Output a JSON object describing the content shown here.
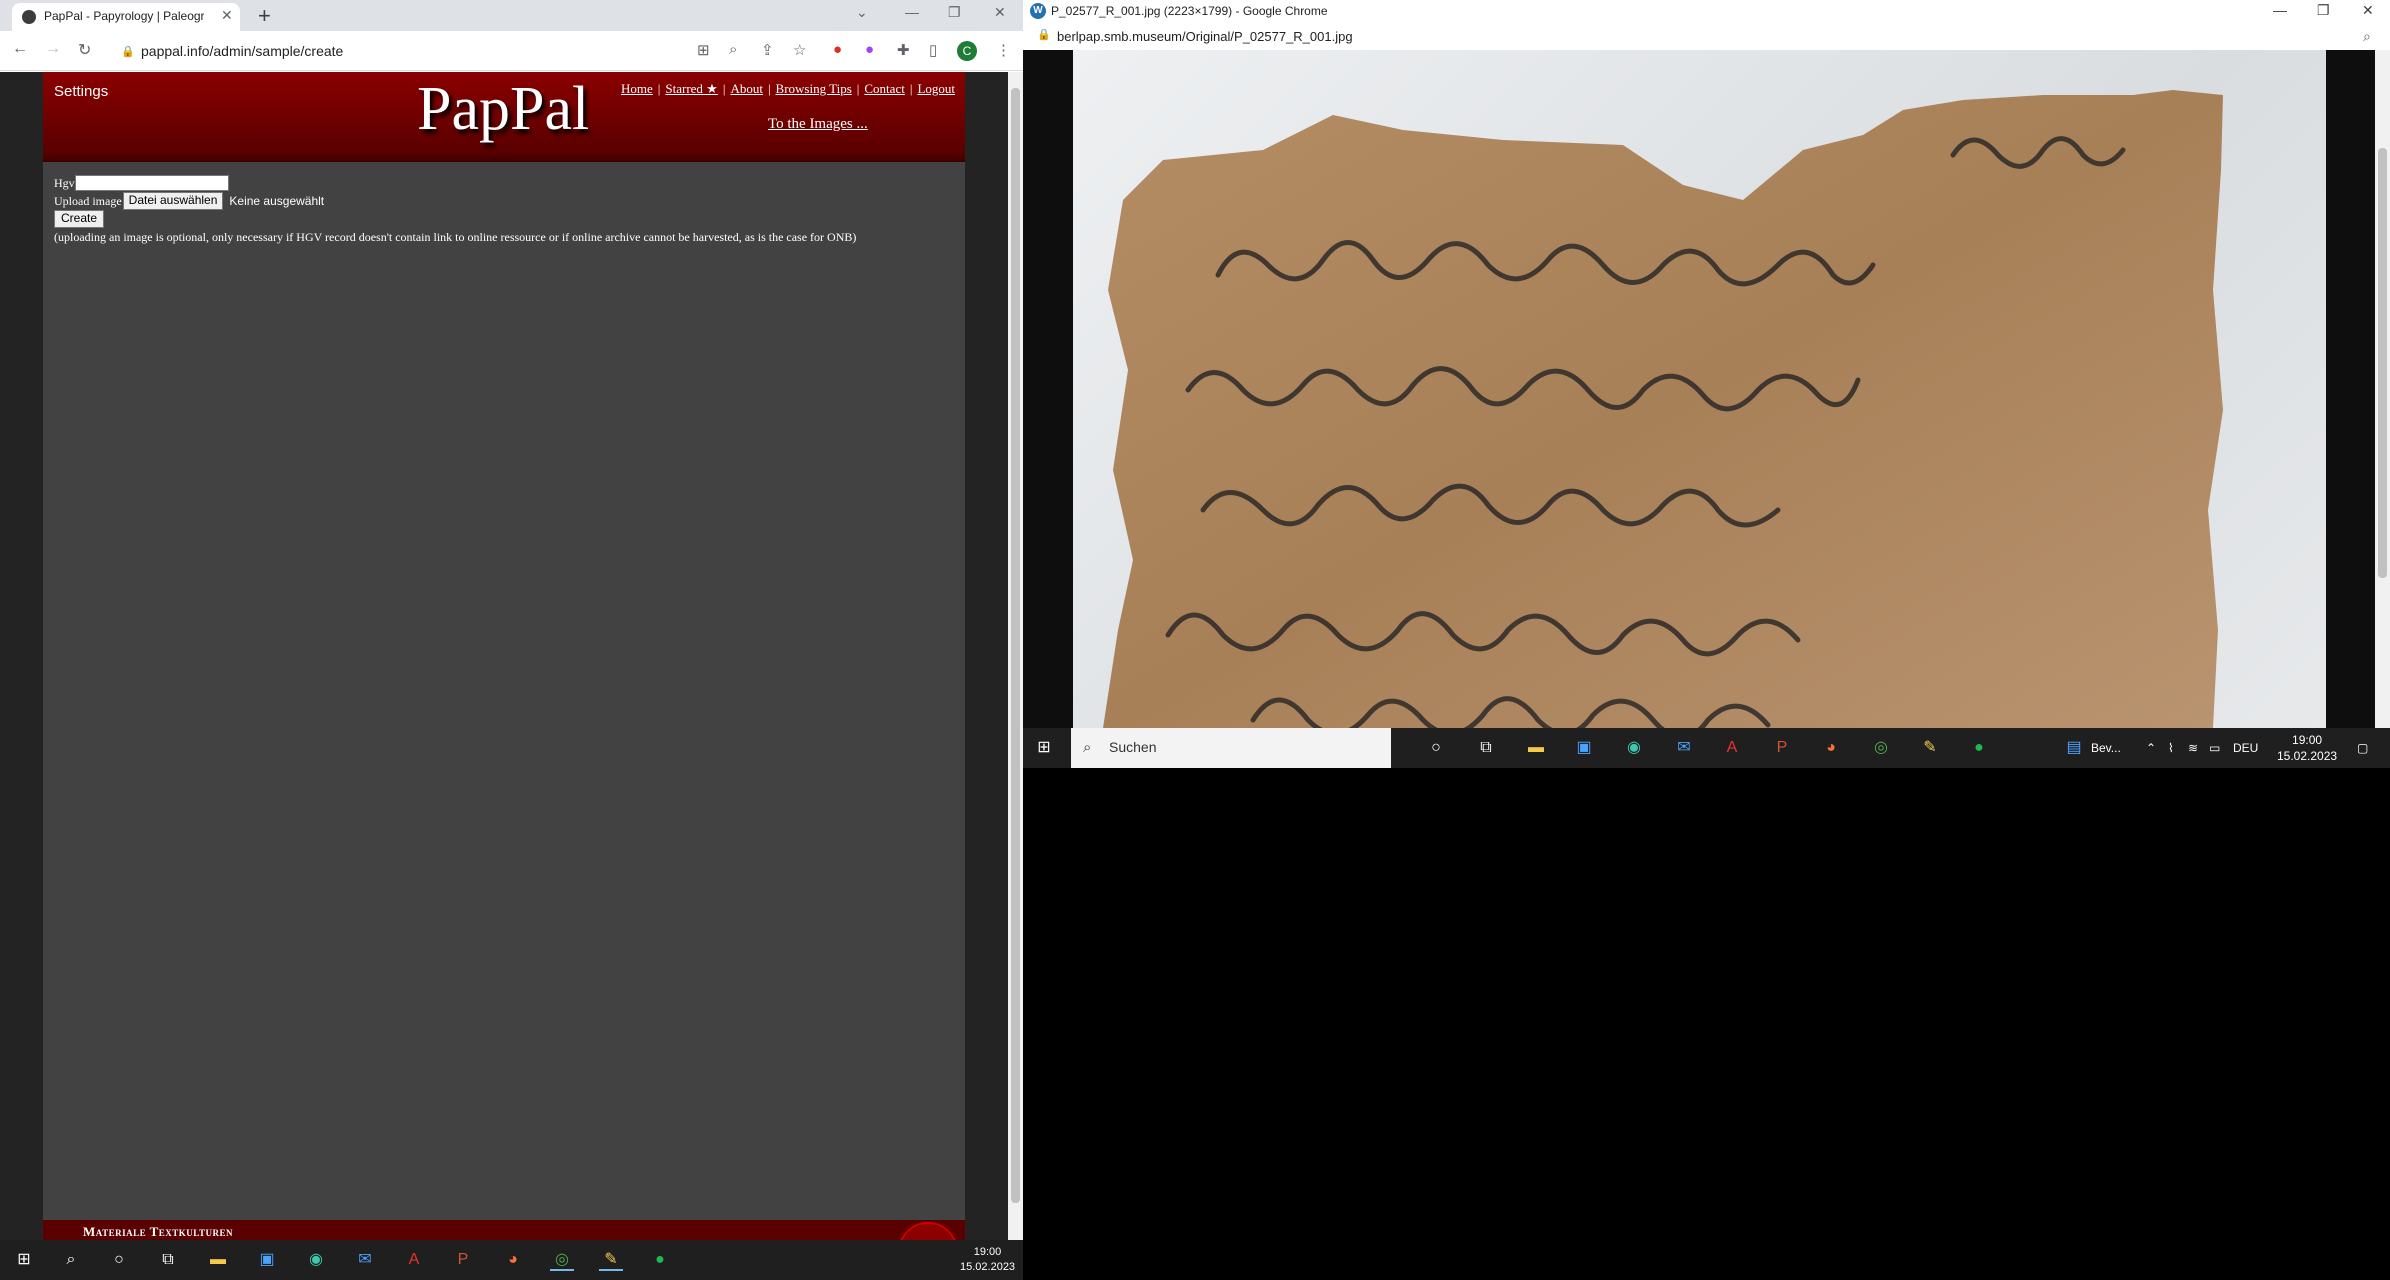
{
  "left_window": {
    "tab_title": "PapPal - Papyrology | Paleograph",
    "url": "pappal.info/admin/sample/create",
    "profile_initial": "C",
    "page": {
      "settings_label": "Settings",
      "logo": "PapPal",
      "nav": {
        "home": "Home",
        "starred": "Starred ★",
        "about": "About",
        "browsing_tips": "Browsing Tips",
        "contact": "Contact",
        "logout": "Logout"
      },
      "to_images": "To the Images ...",
      "form": {
        "hgv_label": "Hgv",
        "hgv_value": "",
        "upload_label": "Upload image",
        "file_button": "Datei auswählen",
        "file_status": "Keine ausgewählt",
        "create_button": "Create",
        "note": "(uploading an image is optional, only necessary if HGV record doesn't contain link to online ressource or if online archive cannot be harvested, as is the case for ONB)"
      },
      "footer_text": "Materiale Textkulturen"
    }
  },
  "right_window": {
    "title": "P_02577_R_001.jpg (2223×1799) - Google Chrome",
    "url": "berlpap.smb.museum/Original/P_02577_R_001.jpg",
    "taskbar": {
      "search_placeholder": "Suchen",
      "pinned_label": "Bev...",
      "language": "DEU",
      "time": "19:00",
      "date": "15.02.2023"
    }
  },
  "taskbar": {
    "time": "19:00",
    "date": "15.02.2023"
  },
  "colors": {
    "header_red": "#8b0000",
    "page_gray": "#424242",
    "papyrus": "#b08a62"
  }
}
